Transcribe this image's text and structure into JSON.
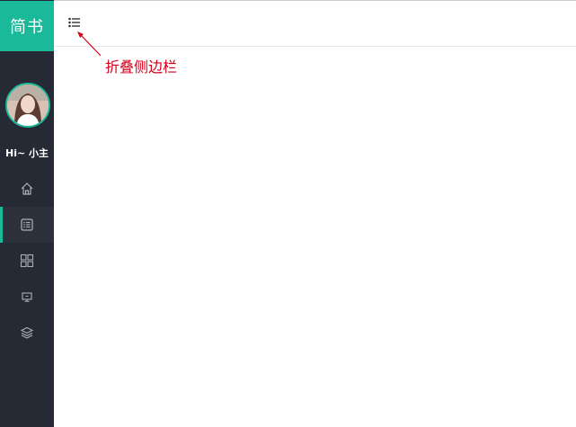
{
  "app": {
    "logo_text": "简书",
    "accent_color": "#19b99a",
    "sidebar_color": "#252a34"
  },
  "user": {
    "greeting": "Hi~ 小主",
    "avatar": "user-avatar-photo"
  },
  "sidebar": {
    "items": [
      {
        "icon": "home-icon",
        "active": false
      },
      {
        "icon": "list-document-icon",
        "active": true
      },
      {
        "icon": "grid-icon",
        "active": false
      },
      {
        "icon": "monitor-icon",
        "active": false
      },
      {
        "icon": "layers-icon",
        "active": false
      }
    ]
  },
  "header": {
    "collapse_icon": "list-toggle-icon"
  },
  "annotation": {
    "text": "折叠侧边栏",
    "color": "#d0021b"
  }
}
